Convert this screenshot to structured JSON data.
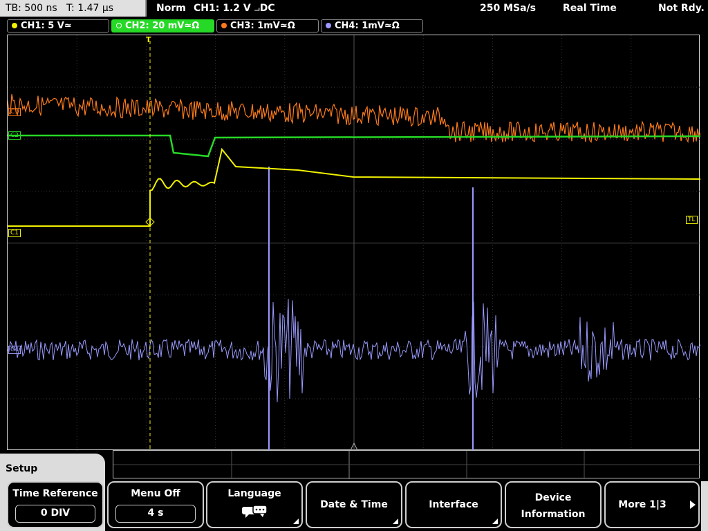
{
  "header": {
    "timebase": "TB: 500 ns",
    "trigger_time": "T: 1.47 µs",
    "trigger_mode": "Norm",
    "trigger_info": "CH1: 1.2 V",
    "trigger_coupling": "DC",
    "sample_rate": "250 MSa/s",
    "acq_mode": "Real Time",
    "status": "Not Rdy."
  },
  "channels": [
    {
      "label": "CH1: 5 V≃",
      "color": "#f2f200",
      "active": false
    },
    {
      "label": "CH2: 20 mV≃Ω",
      "color": "#26d926",
      "active": true
    },
    {
      "label": "CH3: 1mV≃Ω",
      "color": "#ff7b1a",
      "active": false
    },
    {
      "label": "CH4: 1mV≃Ω",
      "color": "#9a9aff",
      "active": false
    }
  ],
  "markers": {
    "ch1": "C1",
    "ch2": "C2",
    "ch3": "C3",
    "ch4": "C4",
    "trigger_level": "TL",
    "trigger_position": "T"
  },
  "menu": {
    "title": "Setup",
    "softkeys": [
      {
        "label": "Time Reference",
        "value": "0 DIV"
      },
      {
        "label": "Menu Off",
        "value": "4 s"
      },
      {
        "label": "Language",
        "icon": "speech-bubbles-icon"
      },
      {
        "label": "Date & Time"
      },
      {
        "label": "Interface"
      },
      {
        "label_line1": "Device",
        "label_line2": "Information"
      },
      {
        "label": "More 1|3"
      }
    ]
  }
}
